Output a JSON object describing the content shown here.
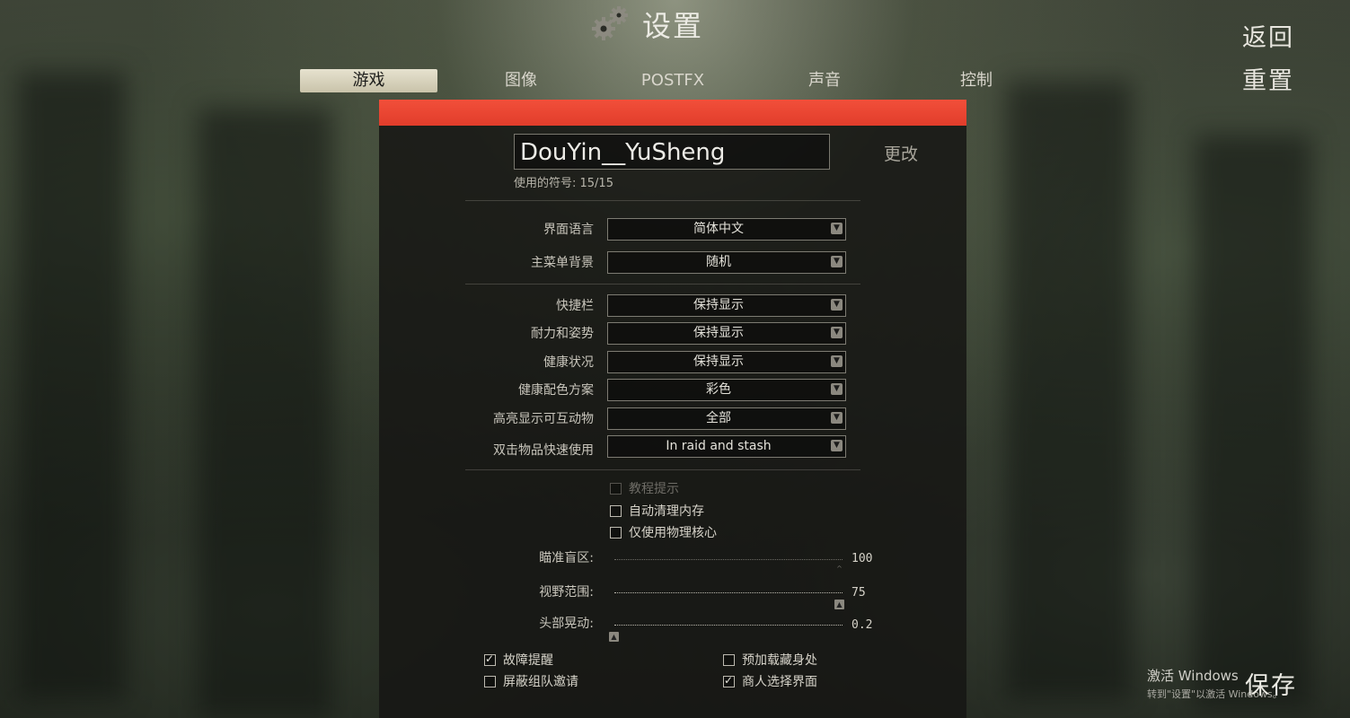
{
  "header": {
    "title": "设置",
    "back_label": "返回",
    "reset_label": "重置",
    "gear_icon": "gears-icon"
  },
  "tabs": [
    {
      "label": "游戏",
      "active": true
    },
    {
      "label": "图像",
      "active": false
    },
    {
      "label": "POSTFX",
      "active": false
    },
    {
      "label": "声音",
      "active": false
    },
    {
      "label": "控制",
      "active": false
    }
  ],
  "profile": {
    "nickname": "DouYin__YuSheng",
    "change_label": "更改",
    "symbols_used": "使用的符号: 15/15"
  },
  "settings": [
    {
      "label": "界面语言",
      "value": "简体中文"
    },
    {
      "label": "主菜单背景",
      "value": "随机"
    },
    {
      "label": "快捷栏",
      "value": "保持显示"
    },
    {
      "label": "耐力和姿势",
      "value": "保持显示"
    },
    {
      "label": "健康状况",
      "value": "保持显示"
    },
    {
      "label": "健康配色方案",
      "value": "彩色"
    },
    {
      "label": "高亮显示可互动物",
      "value": "全部"
    },
    {
      "label": "双击物品快速使用",
      "value": "In raid and stash"
    }
  ],
  "options": [
    {
      "label": "教程提示",
      "checked": false,
      "disabled": true
    },
    {
      "label": "自动清理内存",
      "checked": false,
      "disabled": false
    },
    {
      "label": "仅使用物理核心",
      "checked": false,
      "disabled": false
    }
  ],
  "sliders": [
    {
      "label": "瞄准盲区:",
      "value": "100",
      "level": 1.0,
      "disabled": true
    },
    {
      "label": "视野范围:",
      "value": "75",
      "level": 1.0,
      "disabled": false
    },
    {
      "label": "头部晃动:",
      "value": "0.2",
      "level": 0.0,
      "disabled": false
    }
  ],
  "bottom_options": [
    {
      "label": "故障提醒",
      "checked": true
    },
    {
      "label": "预加载藏身处",
      "checked": false
    },
    {
      "label": "屏蔽组队邀请",
      "checked": false
    },
    {
      "label": "商人选择界面",
      "checked": true
    }
  ],
  "watermark": {
    "line1": "激活 Windows",
    "line2": "转到\"设置\"以激活 Windows。"
  },
  "footer": {
    "save_label": "保存"
  },
  "colors": {
    "accent_bar": "#e8432f",
    "panel_bg": "#161614"
  }
}
